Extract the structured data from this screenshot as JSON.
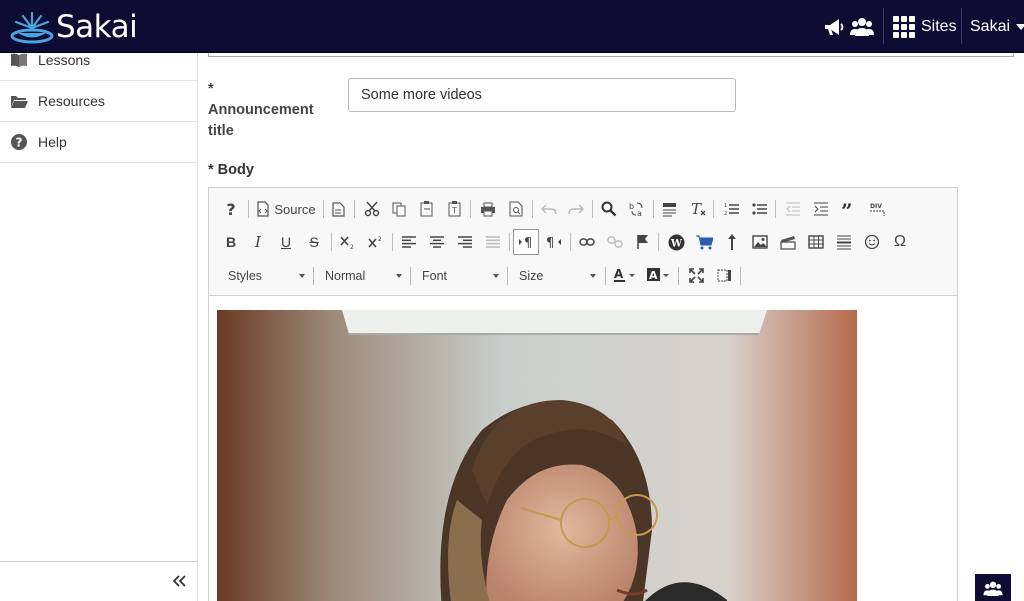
{
  "brand": {
    "name": "Sakai",
    "color": "#0f0c33"
  },
  "topbar": {
    "icons": [
      "megaphone-icon",
      "users-icon",
      "grid-icon"
    ],
    "sites_label": "Sites",
    "user_label": "Sakai"
  },
  "sidebar": {
    "items": [
      {
        "label": "Lessons",
        "icon": "book-icon"
      },
      {
        "label": "Resources",
        "icon": "folder-icon"
      },
      {
        "label": "Help",
        "icon": "help-icon"
      }
    ],
    "collapse_icon": "double-chevron-left-icon"
  },
  "form": {
    "title_label_star": "*",
    "title_label": "Announcement title",
    "title_value": "Some more videos",
    "body_label": "* Body"
  },
  "editor": {
    "source_label": "Source",
    "combos": {
      "styles": "Styles",
      "format": "Normal",
      "font": "Font",
      "size": "Size"
    },
    "content_image": "webcam-photo-woman-with-glasses"
  }
}
